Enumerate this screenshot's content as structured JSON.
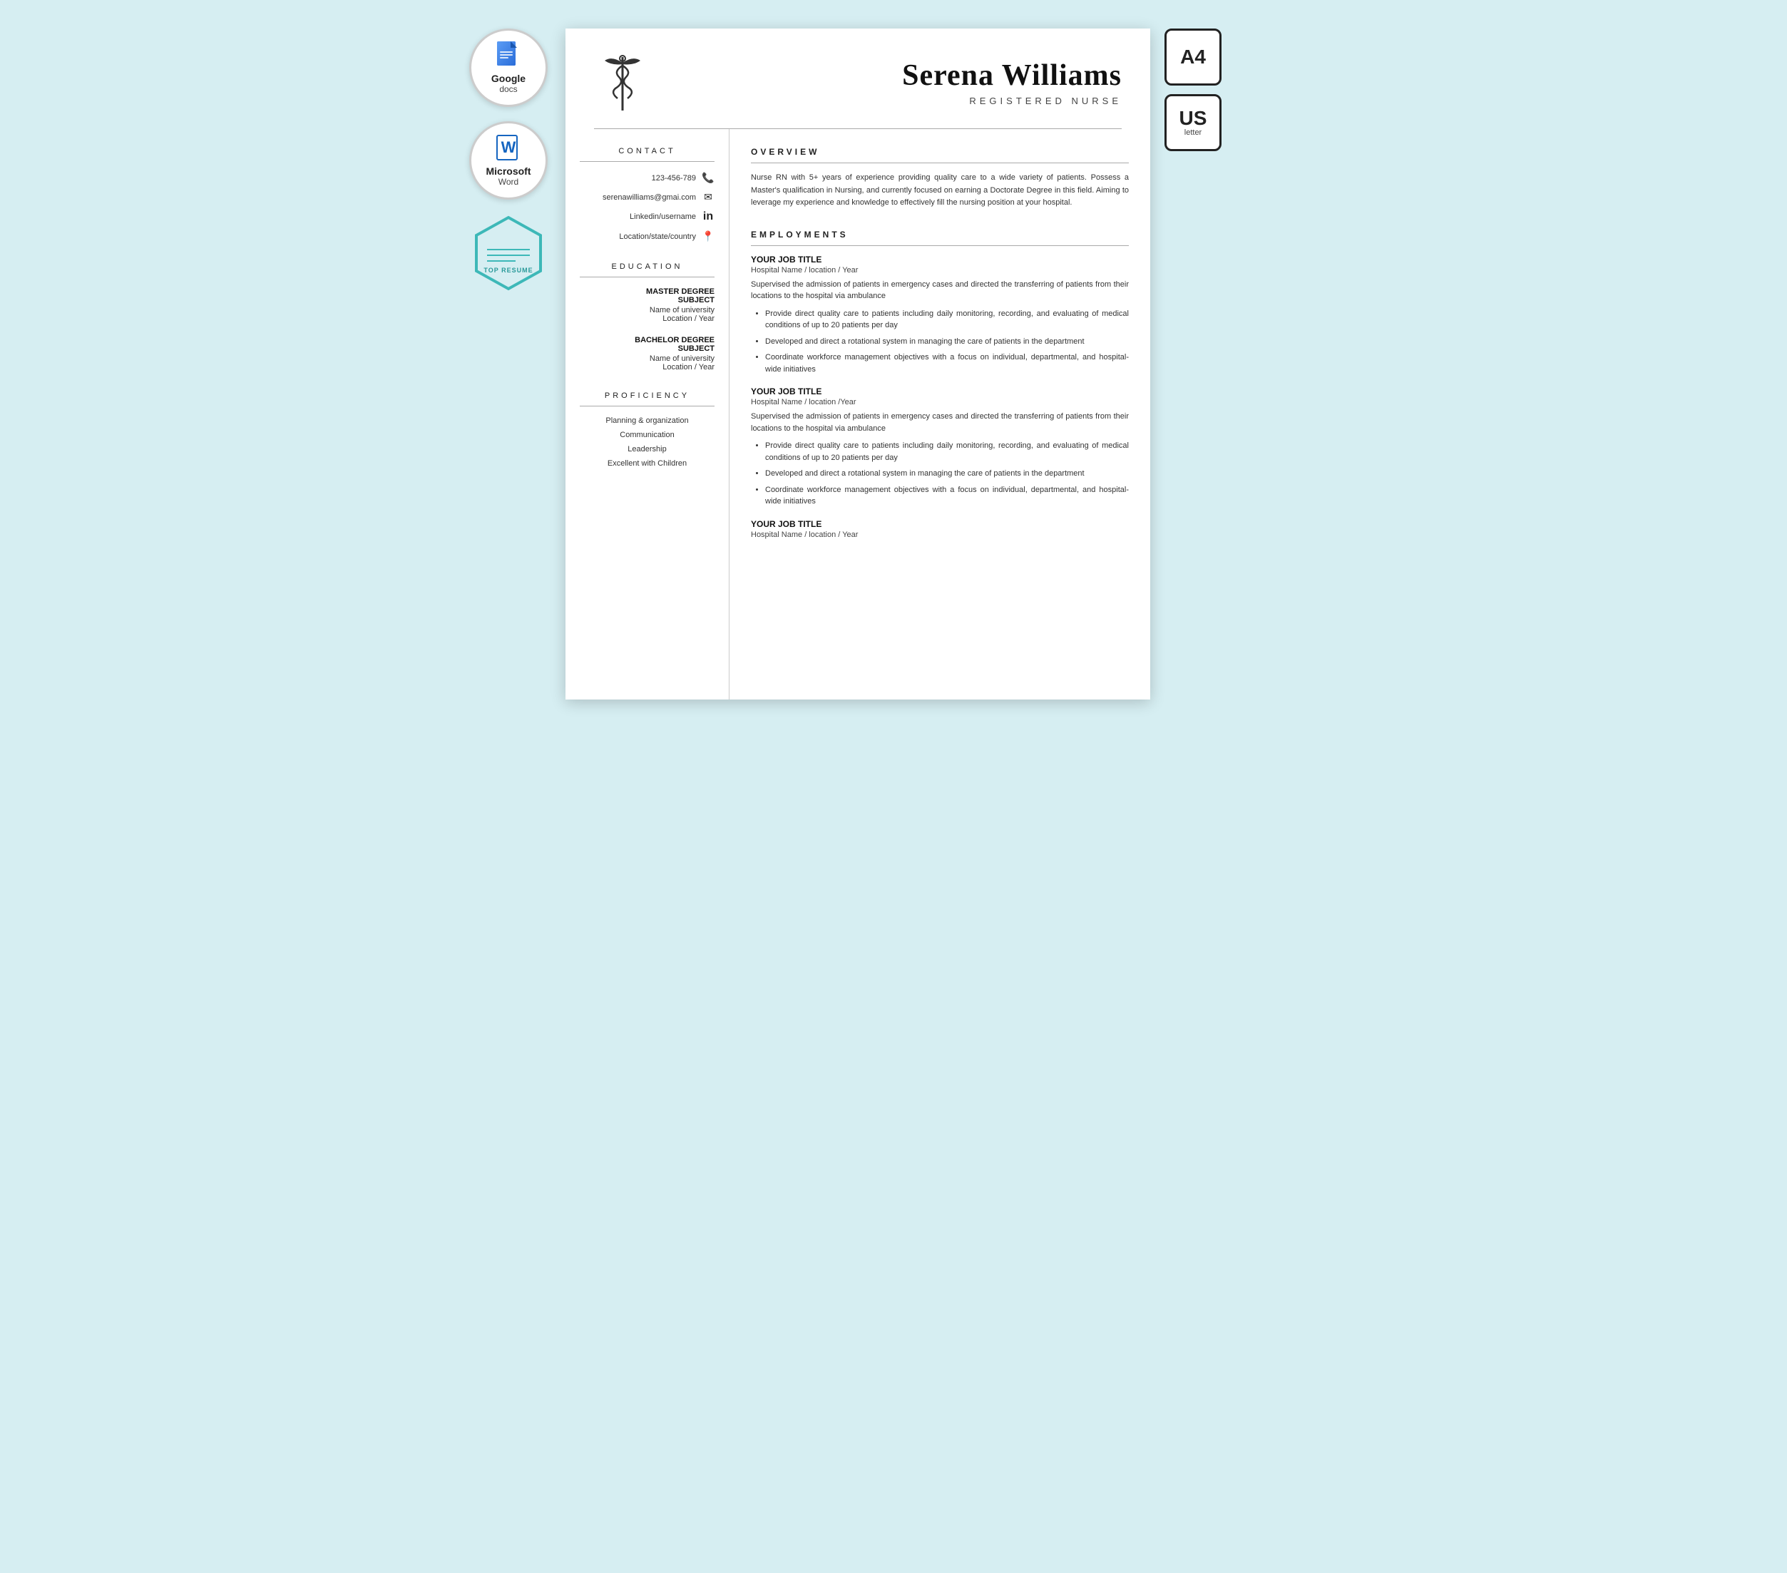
{
  "page": {
    "background_color": "#d6eef2"
  },
  "badges": {
    "google_docs": {
      "label": "Google",
      "sublabel": "docs"
    },
    "microsoft_word": {
      "label": "Microsoft",
      "sublabel": "Word"
    },
    "top_resume": {
      "label": "TOP RESUME"
    },
    "a4": {
      "label": "A4"
    },
    "us_letter": {
      "label": "US",
      "sublabel": "letter"
    }
  },
  "resume": {
    "name": "Serena Williams",
    "title": "REGISTERED NURSE",
    "contact_section_title": "CONTACT",
    "phone": "123-456-789",
    "email": "serenawilliams@gmai.com",
    "linkedin": "Linkedin/username",
    "location": "Location/state/country",
    "education_section_title": "EDUCATION",
    "education": [
      {
        "degree": "MASTER DEGREE",
        "subject": "SUBJECT",
        "university": "Name of university",
        "location_year": "Location / Year"
      },
      {
        "degree": "BACHELOR DEGREE",
        "subject": "SUBJECT",
        "university": "Name of university",
        "location_year": "Location / Year"
      }
    ],
    "proficiency_section_title": "PROFICIENCY",
    "proficiency": [
      "Planning & organization",
      "Communication",
      "Leadership",
      "Excellent with Children"
    ],
    "overview_section_title": "OVERVIEW",
    "overview_text": "Nurse RN with 5+ years of experience providing quality care to a wide variety of patients. Possess a Master's qualification in Nursing, and currently focused on earning a Doctorate Degree in this field. Aiming to leverage my experience and knowledge to effectively fill the nursing position at your hospital.",
    "employment_section_title": "EMPLOYMENTS",
    "jobs": [
      {
        "title": "YOUR JOB TITLE",
        "location": "Hospital Name / location / Year",
        "description": "Supervised the admission of patients in emergency cases and directed the transferring of patients from their locations to the hospital via ambulance",
        "bullets": [
          "Provide direct quality care to patients including daily monitoring, recording, and evaluating of medical conditions of up to 20 patients per day",
          "Developed  and direct a rotational system in managing the care of patients in the department",
          "Coordinate workforce management objectives with a focus on individual, departmental, and hospital-wide initiatives"
        ]
      },
      {
        "title": "YOUR JOB TITLE",
        "location": "Hospital Name / location /Year",
        "description": "Supervised the admission of patients in emergency cases and directed the transferring of patients from their locations to the hospital via ambulance",
        "bullets": [
          "Provide direct quality care to patients including daily monitoring, recording, and evaluating of medical conditions of up to 20 patients per day",
          "Developed  and direct a rotational system in managing the care of patients in the department",
          "Coordinate workforce management objectives with a focus on individual, departmental, and hospital-wide initiatives"
        ]
      },
      {
        "title": "YOUR JOB TITLE",
        "location": "Hospital Name / location / Year",
        "description": "",
        "bullets": []
      }
    ]
  }
}
